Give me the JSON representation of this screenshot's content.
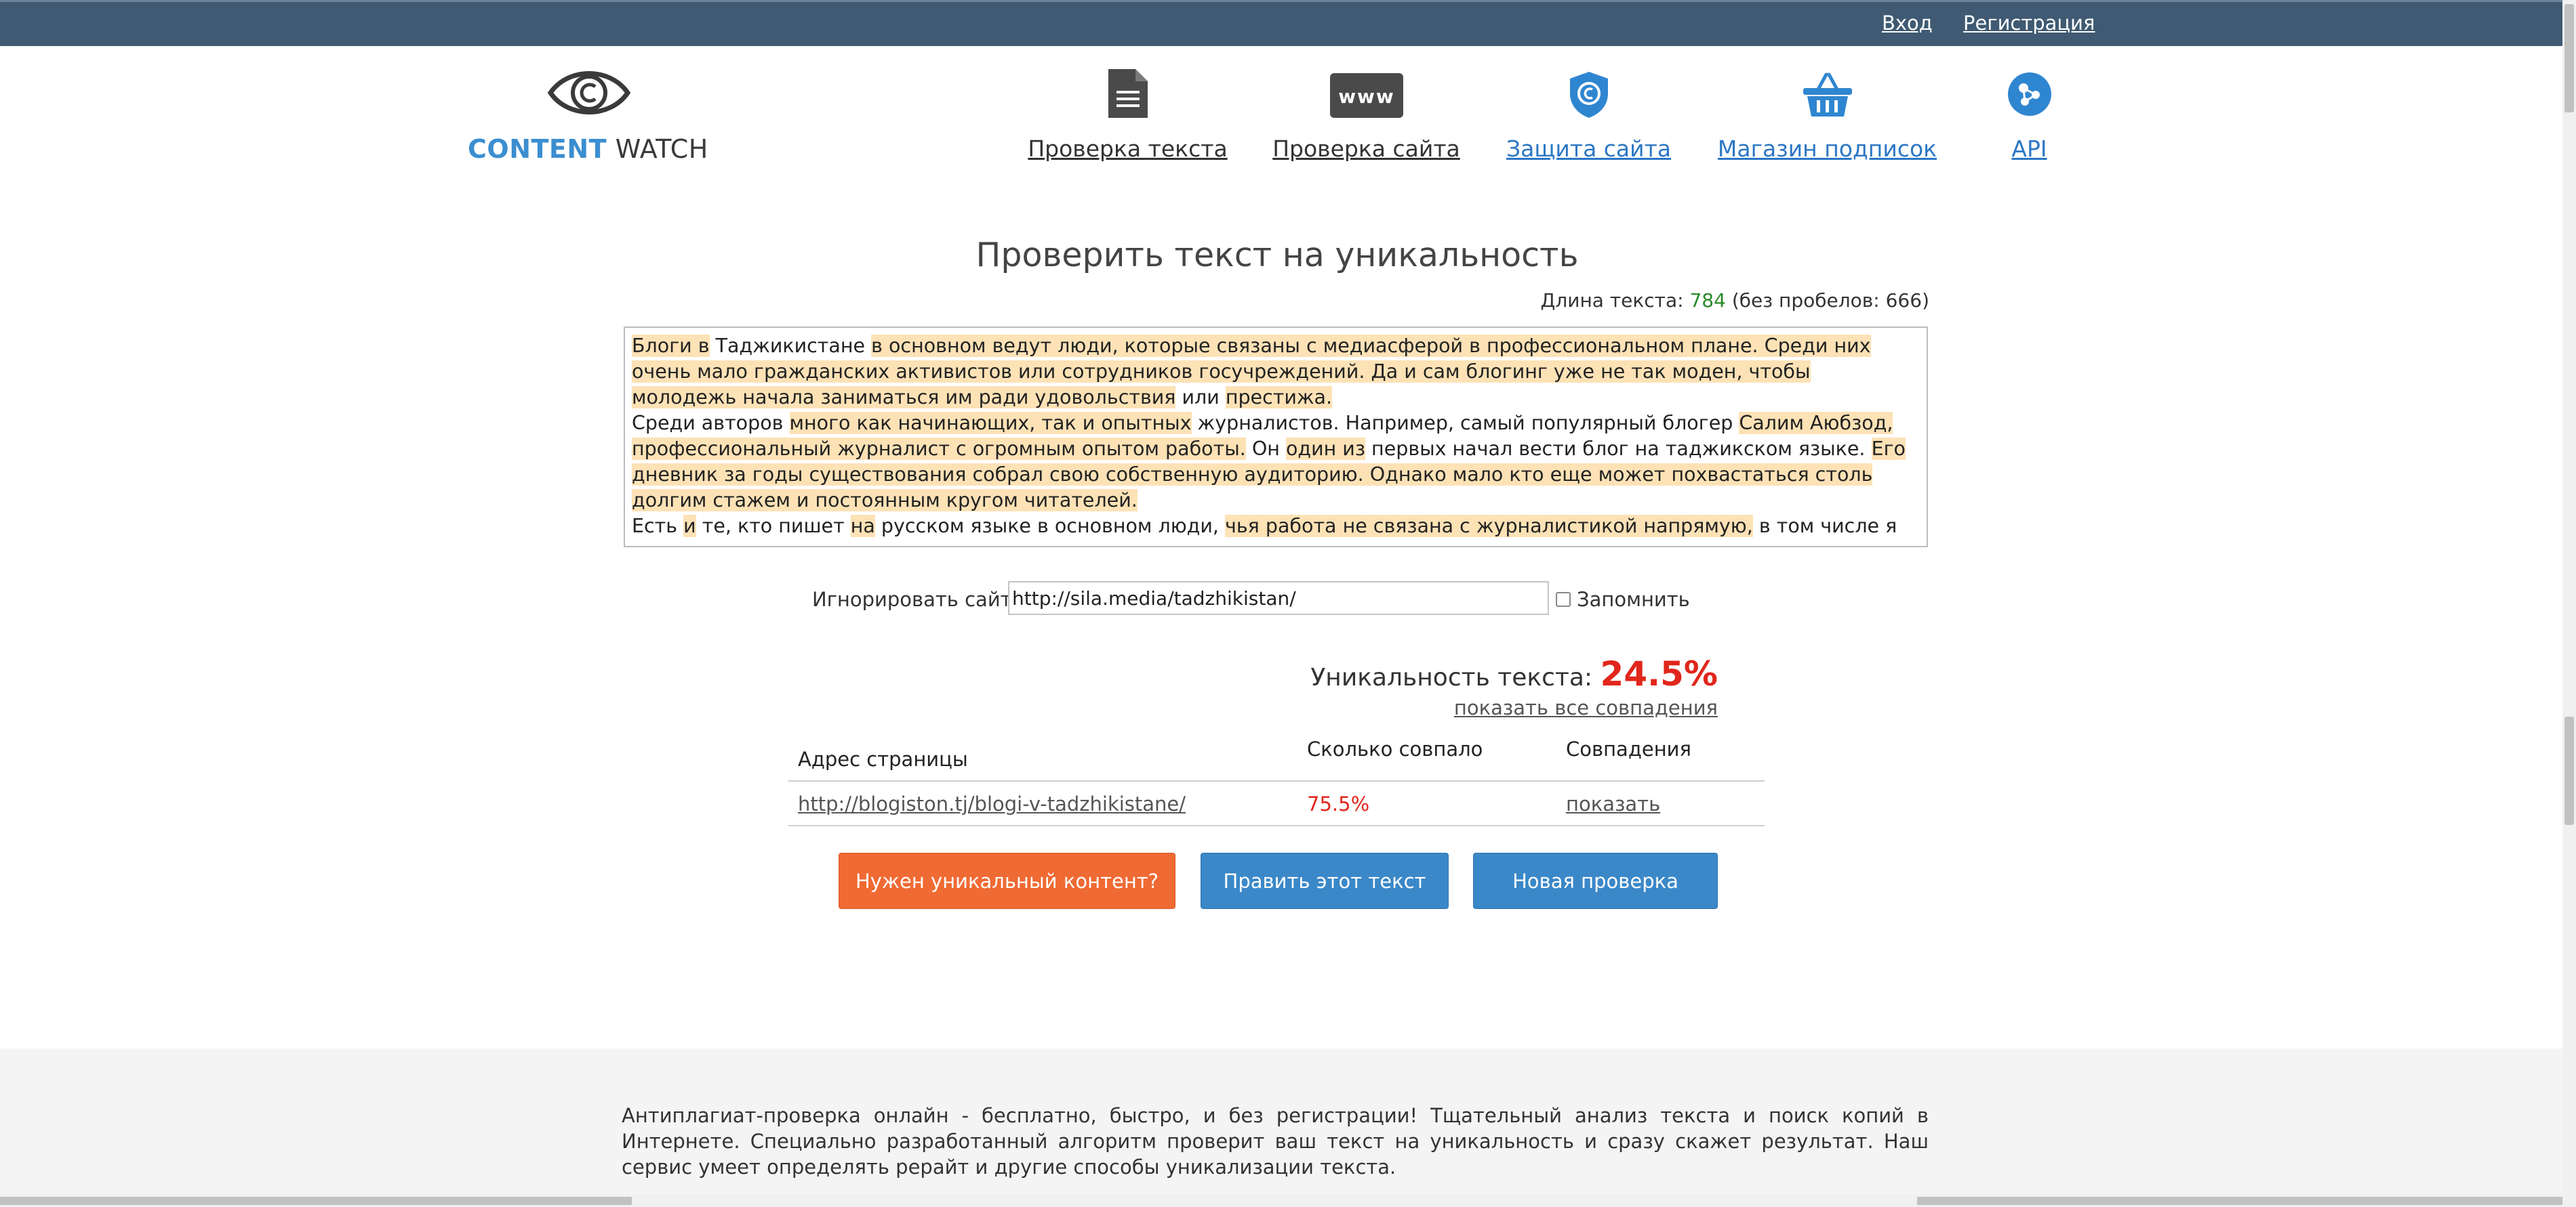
{
  "topbar": {
    "login": "Вход",
    "register": "Регистрация"
  },
  "logo": {
    "part1": "CONTENT",
    "part2": "WATCH",
    "icon": "eye-copyright-icon"
  },
  "nav": [
    {
      "label": "Проверка текста",
      "icon": "document-icon"
    },
    {
      "label": "Проверка сайта",
      "icon": "www-icon"
    },
    {
      "label": "Защита сайта",
      "icon": "shield-icon"
    },
    {
      "label": "Магазин подписок",
      "icon": "basket-icon"
    },
    {
      "label": "API",
      "icon": "api-nodes-icon"
    }
  ],
  "main": {
    "title": "Проверить текст на уникальность",
    "length": {
      "prefix": "Длина текста:",
      "value": "784",
      "suffix": "(без пробелов: 666)"
    },
    "text_paragraphs": [
      [
        {
          "t": "Блоги в",
          "h": true
        },
        {
          "t": " Таджикистане ",
          "h": false
        },
        {
          "t": "в основном ведут люди, которые связаны с медиасферой в профессиональном плане. Среди них очень мало гражданских активистов или сотрудников госучреждений. Да и сам блогинг уже не так моден, чтобы молодежь начала заниматься им ради удовольствия",
          "h": true
        },
        {
          "t": " или ",
          "h": false
        },
        {
          "t": "престижа.",
          "h": true
        }
      ],
      [
        {
          "t": "Среди авторов ",
          "h": false
        },
        {
          "t": "много как начинающих, так и опытных",
          "h": true
        },
        {
          "t": " журналистов. Например, самый популярный блогер ",
          "h": false
        },
        {
          "t": "Салим Аюбзод, профессиональный журналист с огромным опытом работы.",
          "h": true
        },
        {
          "t": " Он ",
          "h": false
        },
        {
          "t": "один из",
          "h": true
        },
        {
          "t": " первых начал вести блог на таджикском языке. ",
          "h": false
        },
        {
          "t": "Его дневник за годы существования собрал свою собственную аудиторию. Однако мало кто еще может похвастаться столь долгим стажем и постоянным кругом читателей.",
          "h": true
        }
      ],
      [
        {
          "t": "Есть ",
          "h": false
        },
        {
          "t": "и",
          "h": true
        },
        {
          "t": " те, кто пишет ",
          "h": false
        },
        {
          "t": "на",
          "h": true
        },
        {
          "t": " русском языке в основном люди, ",
          "h": false
        },
        {
          "t": "чья работа не связана с журналистикой напрямую,",
          "h": true
        },
        {
          "t": " в том числе я сам.",
          "h": false
        }
      ]
    ],
    "ignore": {
      "label": "Игнорировать сайт:",
      "value": "http://sila.media/tadzhikistan/",
      "remember_label": "Запомнить",
      "remember_checked": false
    },
    "uniqueness": {
      "label": "Уникальность текста:",
      "value": "24.5%",
      "show_all": "показать все совпадения"
    },
    "table": {
      "headers": [
        "Адрес страницы",
        "Сколько совпало",
        "Совпадения"
      ],
      "rows": [
        {
          "url": "http://blogiston.tj/blogi-v-tadzhikistane/",
          "percent": "75.5%",
          "action": "показать"
        }
      ]
    },
    "buttons": {
      "need_content": "Нужен уникальный контент?",
      "edit_text": "Править этот текст",
      "new_check": "Новая проверка"
    }
  },
  "footer": {
    "text": "Антиплагиат-проверка онлайн - бесплатно, быстро, и без регистрации! Тщательный анализ текста и поиск копий в Интернете. Специально разработанный алгоритм проверит ваш текст на уникальность и сразу скажет результат. Наш сервис умеет определять рерайт и другие способы уникализации текста."
  },
  "colors": {
    "topbar": "#3f5a72",
    "brand_blue": "#3b8ed0",
    "highlight": "#fde2b6",
    "accent_red": "#e1261c",
    "button_orange": "#f06a33",
    "button_blue": "#3b88c8",
    "length_green": "#2a8a2a"
  }
}
